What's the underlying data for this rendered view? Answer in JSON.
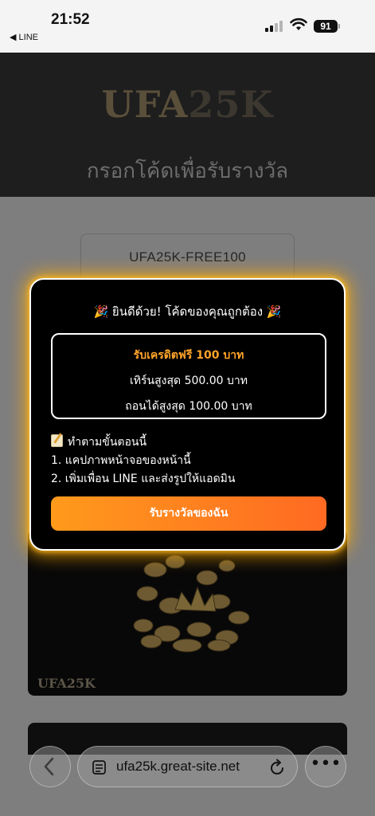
{
  "status_bar": {
    "time": "21:52",
    "back_app": "◀ LINE",
    "battery": "91"
  },
  "header": {
    "logo_main": "UFA",
    "logo_accent": "25K",
    "subtitle": "กรอกโค้ดเพื่อรับรางวัล"
  },
  "form": {
    "code_value": "UFA25K-FREE100"
  },
  "promo_card": {
    "brand": "UFA25K"
  },
  "modal": {
    "title_party_left": "🎉",
    "title": "ยินดีด้วย! โค้ดของคุณถูกต้อง",
    "title_party_right": "🎉",
    "reward_headline": "รับเครดิตฟรี 100 บาท",
    "reward_line_1": "เทิร์นสูงสุด 500.00 บาท",
    "reward_line_2": "ถอนได้สูงสุด 100.00 บาท",
    "steps_title": "ทำตามขั้นตอนนี้",
    "step_1": "1. แคปภาพหน้าจอของหน้านี้",
    "step_2": "2. เพิ่มเพื่อน LINE และส่งรูปให้แอดมิน",
    "claim_label": "รับรางวัลของฉัน"
  },
  "browser": {
    "url": "ufa25k.great-site.net",
    "more_label": "•••"
  },
  "colors": {
    "modal_glow": "#ffaa00",
    "reward_accent": "#ffa42a",
    "button_start": "#ff9a1c",
    "button_end": "#ff6a22"
  }
}
